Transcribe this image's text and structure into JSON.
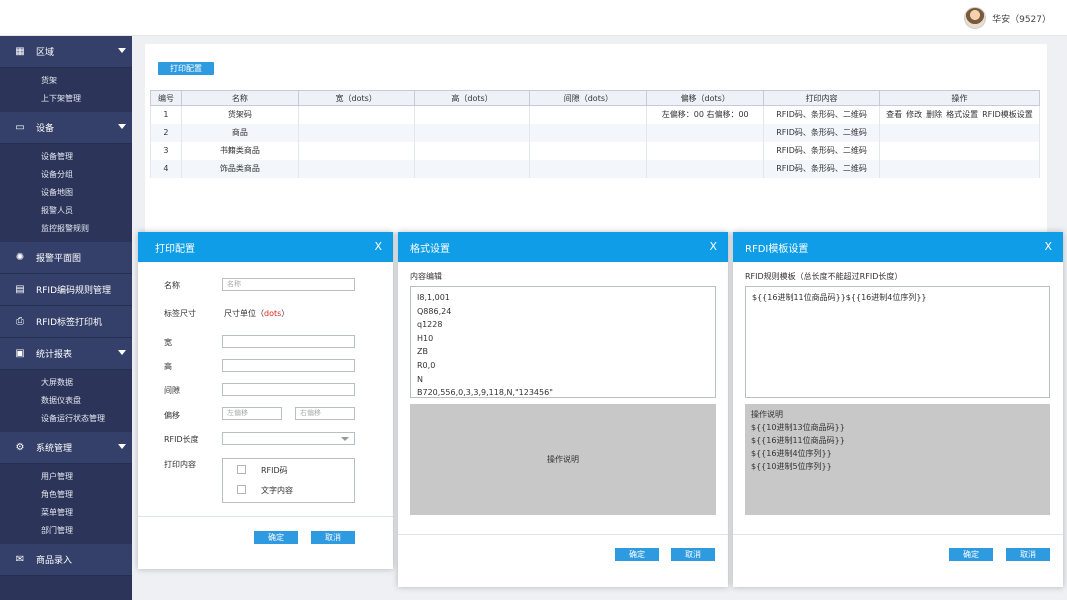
{
  "user": {
    "name": "华安（9527）"
  },
  "sidebar": {
    "groups": [
      {
        "label": "区域",
        "icon": "map-icon",
        "items": [
          "货架",
          "上下架管理"
        ]
      },
      {
        "label": "设备",
        "icon": "monitor-icon",
        "items": [
          "设备管理",
          "设备分组",
          "设备地图",
          "报警人员",
          "监控报警规则"
        ]
      }
    ],
    "singles": [
      {
        "label": "报警平面图",
        "icon": "alarm-light-icon"
      },
      {
        "label": "RFID编码规则管理",
        "icon": "card-icon"
      },
      {
        "label": "RFID标签打印机",
        "icon": "printer-icon"
      }
    ],
    "groups2": [
      {
        "label": "统计报表",
        "icon": "report-icon",
        "items": [
          "大屏数据",
          "数据仪表盘",
          "设备运行状态管理"
        ]
      },
      {
        "label": "系统管理",
        "icon": "gear-icon",
        "items": [
          "用户管理",
          "角色管理",
          "菜单管理",
          "部门管理"
        ]
      }
    ],
    "bottom": {
      "label": "商品录入",
      "icon": "mail-icon"
    }
  },
  "main": {
    "config_button": "打印配置",
    "table": {
      "headers": [
        "编号",
        "名称",
        "宽（dots）",
        "高（dots）",
        "间隙（dots）",
        "偏移（dots）",
        "打印内容",
        "操作"
      ],
      "rows": [
        {
          "id": "1",
          "name": "货架码",
          "w": "",
          "h": "",
          "gap": "",
          "offset": "左偏移：00   右偏移：00",
          "content": "RFID码、条形码、二维码",
          "ops": [
            "查看",
            "修改",
            "删除",
            "格式设置",
            "RFID模板设置"
          ]
        },
        {
          "id": "2",
          "name": "商品",
          "w": "",
          "h": "",
          "gap": "",
          "offset": "",
          "content": "RFID码、条形码、二维码",
          "ops": []
        },
        {
          "id": "3",
          "name": "书籍类商品",
          "w": "",
          "h": "",
          "gap": "",
          "offset": "",
          "content": "RFID码、条形码、二维码",
          "ops": []
        },
        {
          "id": "4",
          "name": "饰品类商品",
          "w": "",
          "h": "",
          "gap": "",
          "offset": "",
          "content": "RFID码、条形码、二维码",
          "ops": []
        }
      ]
    }
  },
  "dialog_print": {
    "title": "打印配置",
    "close": "X",
    "name_label": "名称",
    "name_placeholder": "名称",
    "size_label": "标签尺寸",
    "unit_text": "尺寸单位（",
    "unit_value": "dots",
    "unit_close": "）",
    "width_label": "宽",
    "height_label": "高",
    "gap_label": "间隙",
    "offset_label": "偏移",
    "left_placeholder": "左偏移",
    "right_placeholder": "右偏移",
    "rfid_len_label": "RFID长度",
    "content_label": "打印内容",
    "opt_rfid": "RFID码",
    "opt_text": "文字内容",
    "ok": "确定",
    "cancel": "取消",
    "accent_red": "#e0251b"
  },
  "dialog_format": {
    "title": "格式设置",
    "close": "X",
    "edit_label": "内容编辑",
    "lines": [
      "I8,1,001",
      "Q886,24",
      "q1228",
      "H10",
      "ZB",
      "R0,0",
      "N",
      "B720,556,0,3,3,9,118,N,\"123456\""
    ],
    "help": "操作说明",
    "ok": "确定",
    "cancel": "取消"
  },
  "dialog_rfid": {
    "title": "RFDI模板设置",
    "close": "X",
    "rule_label": "RFID规则模板（总长度不能超过RFID长度）",
    "template": "${{16进制11位商品码}}${{16进制4位序列}}",
    "help_title": "操作说明",
    "help_lines": [
      "${{10进制13位商品码}}",
      "${{16进制11位商品码}}",
      "${{16进制4位序列}}",
      "${{10进制5位序列}}"
    ],
    "ok": "确定",
    "cancel": "取消"
  },
  "colors": {
    "sidebar": "#2c3559",
    "header_blue": "#0e9de6",
    "button_blue": "#2e9ae0",
    "link_blue": "#2e8bd6"
  }
}
